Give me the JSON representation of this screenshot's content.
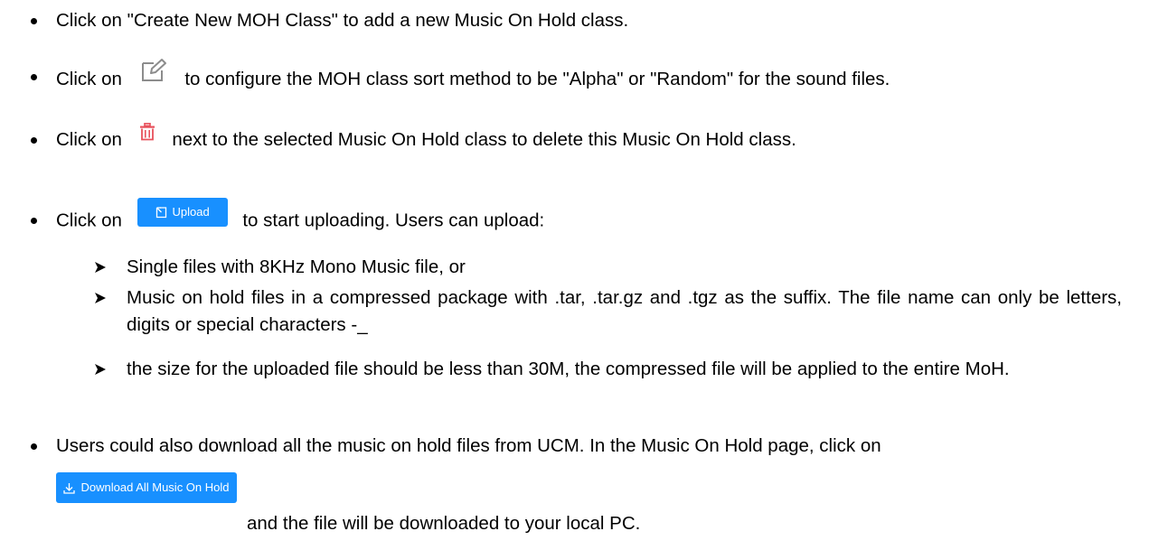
{
  "bullets": {
    "create": "Click on \"Create New MOH Class\" to add a new Music On Hold class.",
    "edit_pre": "Click on",
    "edit_post": "to configure the MOH class sort method to be \"Alpha\" or \"Random\" for the sound files.",
    "delete_pre": "Click on",
    "delete_post": "next to the selected Music On Hold class to delete this Music On Hold class.",
    "upload_pre": "Click on",
    "upload_post": "to start uploading. Users can upload:",
    "sub_items": [
      "Single files with 8KHz Mono Music file, or",
      "Music on hold files in a compressed package with .tar, .tar.gz and .tgz as the suffix. The file name can only be letters, digits or special characters -_",
      "the size for the uploaded file should be less than 30M, the compressed file will be applied to the entire MoH."
    ],
    "download_line1": "Users could also download all the music on hold files from UCM. In the Music On Hold page, click on",
    "download_post": "and the file will be downloaded to your local PC."
  },
  "buttons": {
    "upload_label": "Upload",
    "download_label": "Download All Music On Hold"
  },
  "icons": {
    "edit": "edit-icon",
    "delete": "trash-icon",
    "upload": "upload-icon",
    "download": "download-icon"
  },
  "colors": {
    "button_blue": "#1890ff",
    "trash_red": "#e8505b",
    "edit_gray": "#8c8c8c"
  }
}
